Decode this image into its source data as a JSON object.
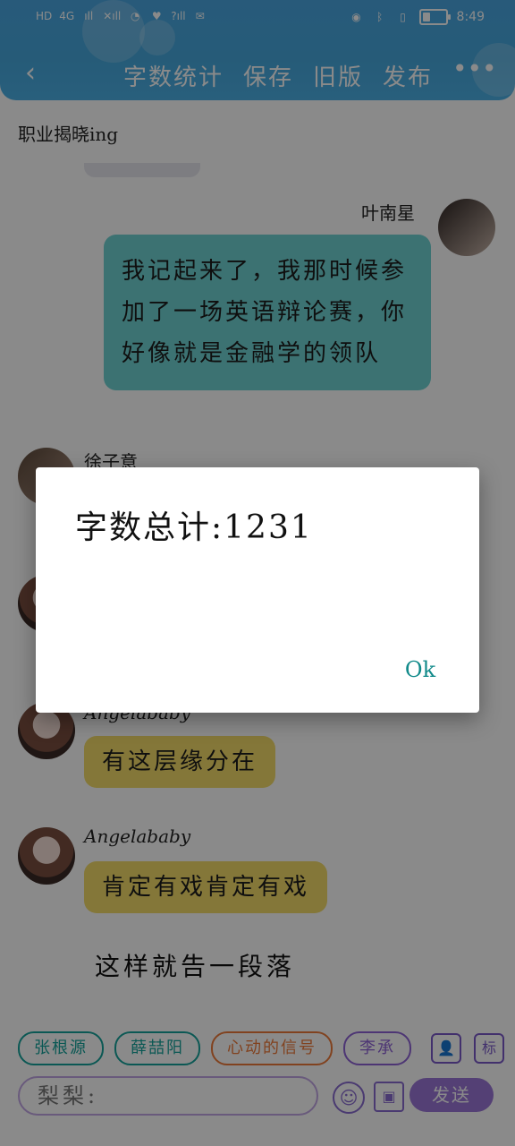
{
  "status_bar": {
    "left_items": [
      "HD",
      "4G",
      "ıll",
      "✕ıll",
      "wifi",
      "♥",
      "?ıll",
      "wechat"
    ],
    "time": "8:49",
    "battery_level": 0.35
  },
  "toolbar": {
    "back_label": "‹",
    "items": [
      "字数统计",
      "保存",
      "旧版",
      "发布"
    ],
    "more_label": "•••"
  },
  "chat": {
    "top_label": "职业揭晓ing",
    "right_message": {
      "sender": "叶南星",
      "text": "我记起来了，我那时候参加了一场英语辩论赛，你好像就是金融学的领队"
    },
    "left_sender_1": "徐子意",
    "left_sender_2_partial": "Angelababy",
    "message_2": "有这层缘分在",
    "left_sender_3": "Angelababy",
    "message_3": "肯定有戏肯定有戏",
    "narration": "这样就告一段落"
  },
  "dialog": {
    "text": "字数总计:1231",
    "ok_label": "Ok"
  },
  "input_panel": {
    "chips": [
      {
        "label": "张根源",
        "color": "#16a39b"
      },
      {
        "label": "薛喆阳",
        "color": "#16a39b"
      },
      {
        "label": "心动的信号",
        "color": "#ef7b3a"
      },
      {
        "label": "李承",
        "color": "#8e63d6"
      }
    ],
    "input_value": "梨梨:",
    "emoji_icon": "☺",
    "image_icon": "▣",
    "send_label": "发送",
    "person_icon": "👤",
    "tag_icon": "标"
  },
  "colors": {
    "header": "#4aa7e2",
    "right_bubble": "#6fd3d3",
    "left_bubble": "#f4dc69",
    "accent_purple": "#9b77d8",
    "ok_text": "#118a8a"
  }
}
